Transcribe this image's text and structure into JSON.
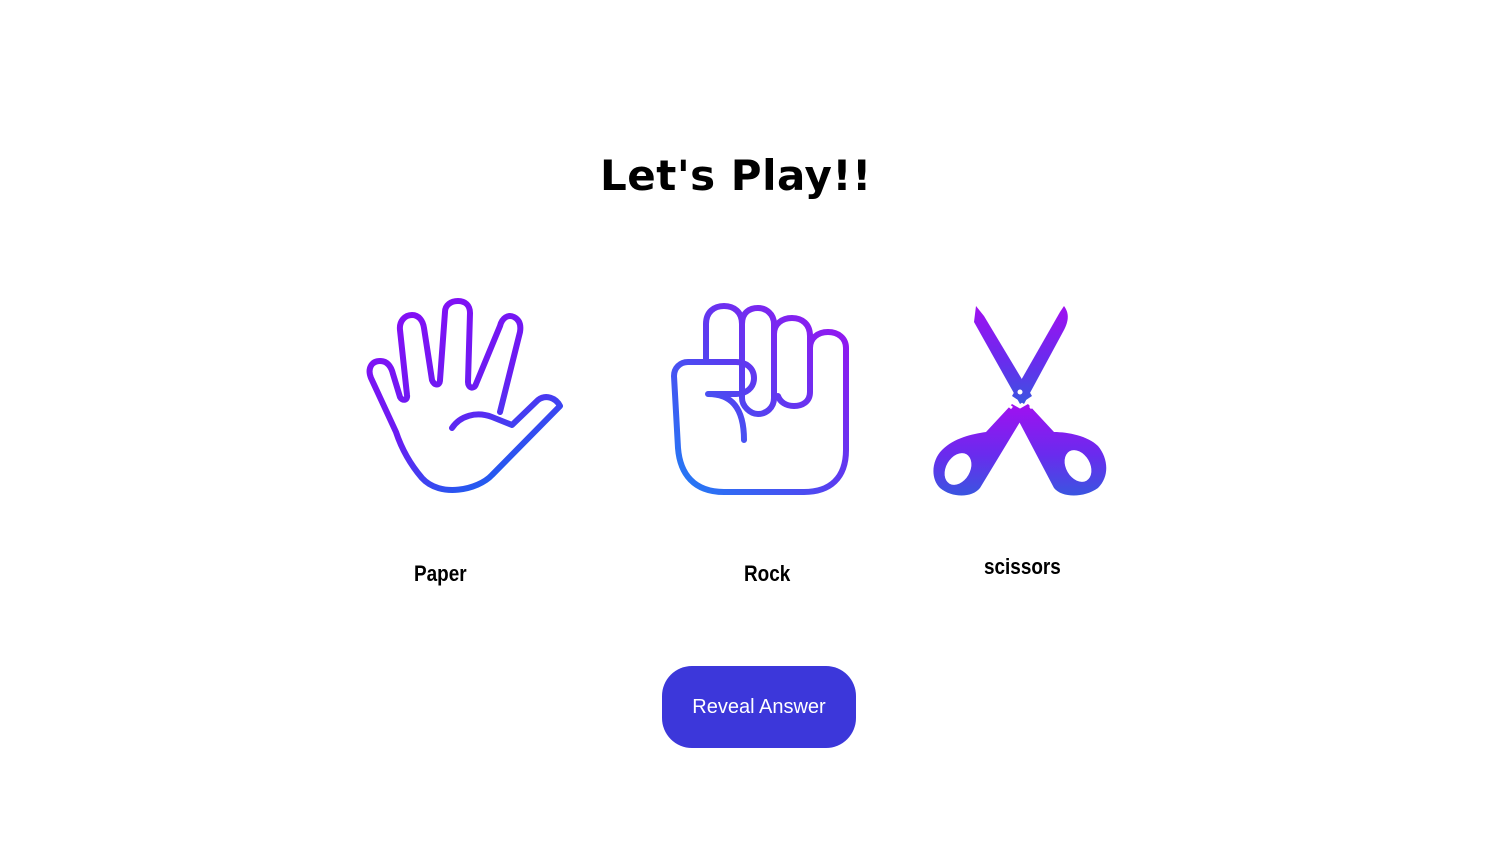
{
  "page": {
    "title": "Let's Play!!"
  },
  "choices": [
    {
      "id": "paper",
      "label": "Paper",
      "icon": "open-hand-icon"
    },
    {
      "id": "rock",
      "label": "Rock",
      "icon": "fist-icon"
    },
    {
      "id": "scissors",
      "label": "scissors",
      "icon": "scissors-icon"
    }
  ],
  "actions": {
    "reveal_label": "Reveal Answer"
  },
  "colors": {
    "gradient_purple": "#9b12f0",
    "gradient_blue": "#1f6ff0",
    "button_bg": "#3c37da",
    "button_text": "#ffffff",
    "text": "#000000",
    "background": "#ffffff"
  }
}
